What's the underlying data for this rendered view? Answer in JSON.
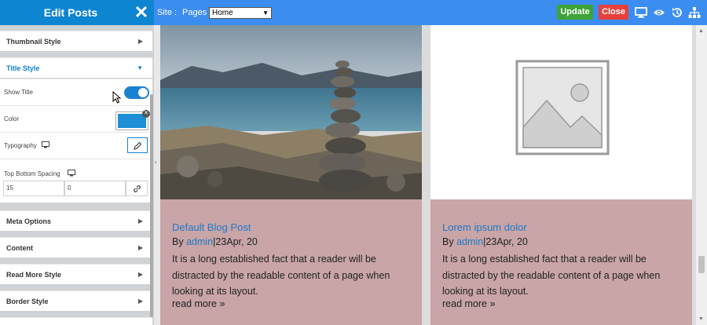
{
  "panel": {
    "title": "Edit Posts",
    "sections": [
      {
        "label": "Thumbnail Style",
        "arrow": "▶"
      },
      {
        "label": "Title Style",
        "arrow": "▼"
      },
      {
        "label": "Meta Options",
        "arrow": "▶"
      },
      {
        "label": "Content",
        "arrow": "▶"
      },
      {
        "label": "Read More Style",
        "arrow": "▶"
      },
      {
        "label": "Border Style",
        "arrow": "▶"
      }
    ],
    "title_style": {
      "show_title_label": "Show Title",
      "show_title_on": true,
      "color_label": "Color",
      "color_value": "#1c8fd6",
      "typography_label": "Typography",
      "spacing_label": "Top Bottom Spacing",
      "spacing_top": "15",
      "spacing_bottom": "0"
    }
  },
  "toolbar": {
    "site_label": "Site :",
    "pages_label": "Pages :",
    "pages_selected": "Home",
    "update_label": "Update",
    "close_label": "Close",
    "icons": [
      "desktop-icon",
      "eye-icon",
      "history-icon",
      "sitemap-icon"
    ]
  },
  "posts": [
    {
      "title": "Default Blog Post",
      "meta_by": "By ",
      "author": "admin",
      "date": "|23Apr, 20",
      "excerpt": "It is a long established fact that a reader will be distracted by the readable content of a page when looking at its layout.",
      "read_more": "read more »",
      "image": "landscape-stone-cairn"
    },
    {
      "title": "Lorem ipsum dolor",
      "meta_by": "By ",
      "author": "admin",
      "date": "|23Apr, 20",
      "excerpt": "It is a long established fact that a reader will be distracted by the readable content of a page when looking at its layout.",
      "read_more": "read more »",
      "image": "placeholder-image"
    }
  ],
  "colors": {
    "topbar": "#3b8df0",
    "panel_header": "#0e85d1",
    "update": "#3ea338",
    "close": "#e8403c",
    "card_body": "#c9a5a7",
    "link": "#1e79c8"
  }
}
